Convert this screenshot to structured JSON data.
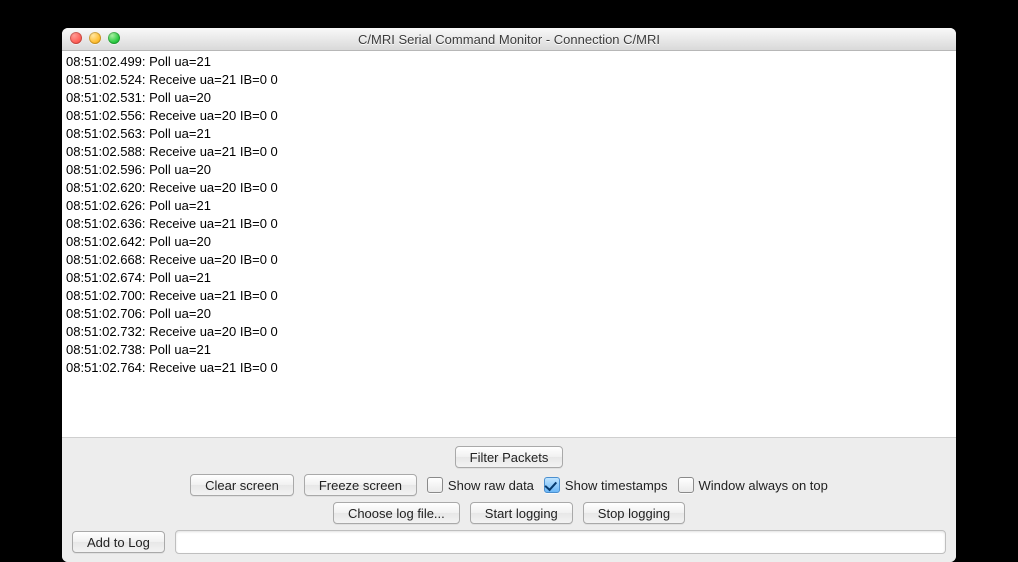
{
  "window": {
    "title": "C/MRI Serial Command Monitor - Connection C/MRI"
  },
  "log_lines": [
    "08:51:02.499: Poll ua=21",
    "08:51:02.524: Receive ua=21 IB=0 0",
    "08:51:02.531: Poll ua=20",
    "08:51:02.556: Receive ua=20 IB=0 0",
    "08:51:02.563: Poll ua=21",
    "08:51:02.588: Receive ua=21 IB=0 0",
    "08:51:02.596: Poll ua=20",
    "08:51:02.620: Receive ua=20 IB=0 0",
    "08:51:02.626: Poll ua=21",
    "08:51:02.636: Receive ua=21 IB=0 0",
    "08:51:02.642: Poll ua=20",
    "08:51:02.668: Receive ua=20 IB=0 0",
    "08:51:02.674: Poll ua=21",
    "08:51:02.700: Receive ua=21 IB=0 0",
    "08:51:02.706: Poll ua=20",
    "08:51:02.732: Receive ua=20 IB=0 0",
    "08:51:02.738: Poll ua=21",
    "08:51:02.764: Receive ua=21 IB=0 0"
  ],
  "controls": {
    "filter_packets": "Filter Packets",
    "clear_screen": "Clear screen",
    "freeze_screen": "Freeze screen",
    "show_raw_data": "Show raw data",
    "show_timestamps": "Show timestamps",
    "window_on_top": "Window always on top",
    "choose_log": "Choose log file...",
    "start_logging": "Start logging",
    "stop_logging": "Stop logging",
    "add_to_log": "Add to Log",
    "show_raw_data_checked": false,
    "show_timestamps_checked": true,
    "window_on_top_checked": false,
    "log_input_value": ""
  }
}
